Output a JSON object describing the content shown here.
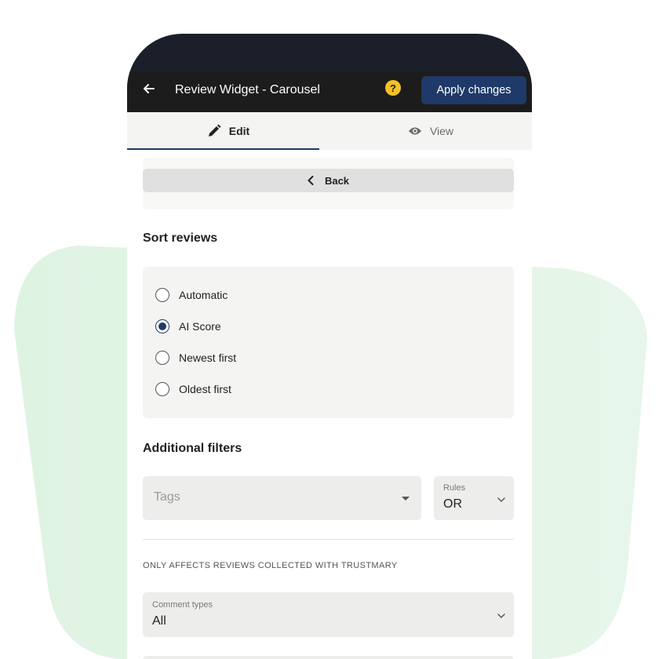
{
  "app": {
    "title": "Review Widget - Carousel",
    "apply_label": "Apply changes",
    "help_label": "?"
  },
  "tabs": [
    {
      "label": "Edit",
      "active": true,
      "icon": "pencil-icon"
    },
    {
      "label": "View",
      "active": false,
      "icon": "eye-icon"
    }
  ],
  "back_label": "Back",
  "sort": {
    "title": "Sort reviews",
    "options": [
      {
        "label": "Automatic",
        "selected": false
      },
      {
        "label": "AI Score",
        "selected": true
      },
      {
        "label": "Newest first",
        "selected": false
      },
      {
        "label": "Oldest first",
        "selected": false
      }
    ]
  },
  "filters": {
    "title": "Additional filters",
    "tags_placeholder": "Tags",
    "rules_label": "Rules",
    "rules_value": "OR",
    "note": "ONLY AFFECTS REVIEWS COLLECTED WITH TRUSTMARY",
    "comment_types_label": "Comment types",
    "comment_types_value": "All"
  },
  "colors": {
    "accent": "#1f3a68",
    "topbar": "#1c1c1c",
    "help": "#f5c024",
    "background_blob": "#e3f4e6"
  }
}
